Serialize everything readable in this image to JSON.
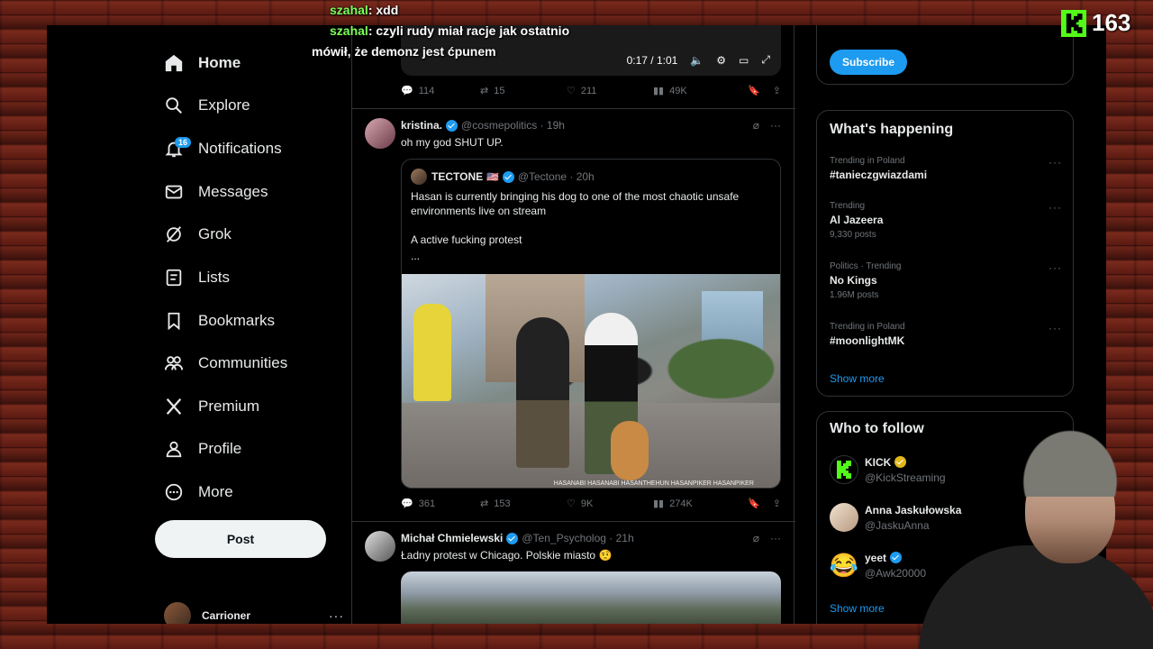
{
  "chat": [
    {
      "user": "szahal",
      "msg": ": xdd"
    },
    {
      "user": "szahal",
      "msg": ": czyli rudy miał racje jak ostatnio"
    },
    {
      "user": "",
      "msg": "mówił, że demonz jest ćpunem"
    }
  ],
  "kick": {
    "viewers": "163"
  },
  "nav": {
    "items": [
      {
        "label": "Home",
        "icon": "home-icon"
      },
      {
        "label": "Explore",
        "icon": "search-icon"
      },
      {
        "label": "Notifications",
        "icon": "bell-icon",
        "badge": "16"
      },
      {
        "label": "Messages",
        "icon": "envelope-icon"
      },
      {
        "label": "Grok",
        "icon": "grok-icon"
      },
      {
        "label": "Lists",
        "icon": "list-icon"
      },
      {
        "label": "Bookmarks",
        "icon": "bookmark-icon"
      },
      {
        "label": "Communities",
        "icon": "people-icon"
      },
      {
        "label": "Premium",
        "icon": "x-logo-icon"
      },
      {
        "label": "Profile",
        "icon": "person-icon"
      },
      {
        "label": "More",
        "icon": "more-circle-icon"
      }
    ],
    "post_label": "Post",
    "account_name": "Carrioner"
  },
  "timeline": {
    "video": {
      "time": "0:17 / 1:01"
    },
    "first_actions": {
      "replies": "114",
      "reposts": "15",
      "likes": "211",
      "views": "49K"
    },
    "tweet1": {
      "name": "kristina.",
      "handle": "@cosmepolitics · 19h",
      "text": "oh my god SHUT UP.",
      "quote": {
        "name": "TECTONE",
        "handle": "@Tectone · 20h",
        "text": "Hasan is currently bringing his dog to one of the most chaotic unsafe environments live on stream",
        "text2": "A active fucking protest",
        "text3": "...",
        "watermark": "HASANABI HASANABI HASANTHEHUN HASANPIKER HASANPIKER"
      },
      "actions": {
        "replies": "361",
        "reposts": "153",
        "likes": "9K",
        "views": "274K"
      }
    },
    "tweet2": {
      "name": "Michał Chmielewski",
      "handle": "@Ten_Psycholog · 21h",
      "text": "Ładny protest w Chicago. Polskie miasto 🤨"
    }
  },
  "right": {
    "subscribe_label": "Subscribe",
    "happening_title": "What's happening",
    "trends": [
      {
        "meta": "Trending in Poland",
        "title": "#tanieczgwiazdami",
        "count": ""
      },
      {
        "meta": "Trending",
        "title": "Al Jazeera",
        "count": "9,330 posts"
      },
      {
        "meta": "Politics · Trending",
        "title": "No Kings",
        "count": "1.96M posts"
      },
      {
        "meta": "Trending in Poland",
        "title": "#moonlightMK",
        "count": ""
      }
    ],
    "show_more": "Show more",
    "follow_title": "Who to follow",
    "follow": [
      {
        "name": "KICK",
        "handle": "@KickStreaming",
        "verified": "gold"
      },
      {
        "name": "Anna Jaskułowska",
        "handle": "@JaskuAnna",
        "verified": ""
      },
      {
        "name": "yeet",
        "handle": "@Awk20000",
        "verified": "blue"
      }
    ],
    "follow_show_more": "Show more"
  },
  "colors": {
    "accent": "#1d9bf0",
    "kick_green": "#53fc18",
    "background": "#000000"
  }
}
